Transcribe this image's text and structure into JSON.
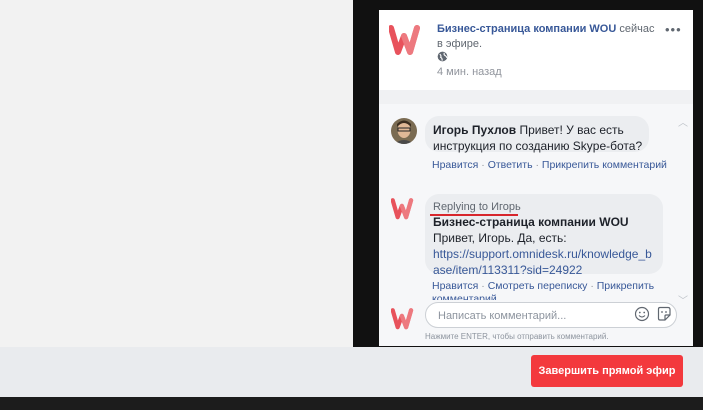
{
  "post": {
    "page_name": "Бизнес-страница компании WOU",
    "status_text": " сейчас в эфире.",
    "time": "4 мин. назад",
    "more_icon": "more-dots-icon",
    "privacy_icon": "globe-icon"
  },
  "comments": [
    {
      "author": "Игорь Пухлов",
      "text": " Привет! У вас есть инструкция по созданию Skype-бота?",
      "actions": [
        "Нравится",
        "Ответить",
        "Прикрепить комментарий"
      ]
    },
    {
      "replying_to": "Replying to Игорь",
      "author": "Бизнес-страница компании WOU",
      "text": "Привет, Игорь. Да, есть:",
      "link": "https://support.omnidesk.ru/knowledge_base/item/113311?sid=24922",
      "actions": [
        "Нравится",
        "Смотреть переписку",
        "Прикрепить комментарий"
      ]
    }
  ],
  "composer": {
    "placeholder": "Написать комментарий...",
    "hint": "Нажмите ENTER, чтобы отправить комментарий."
  },
  "footer": {
    "end_button": "Завершить прямой эфир"
  },
  "colors": {
    "brand_red": "#f3393d",
    "link_blue": "#385898"
  }
}
